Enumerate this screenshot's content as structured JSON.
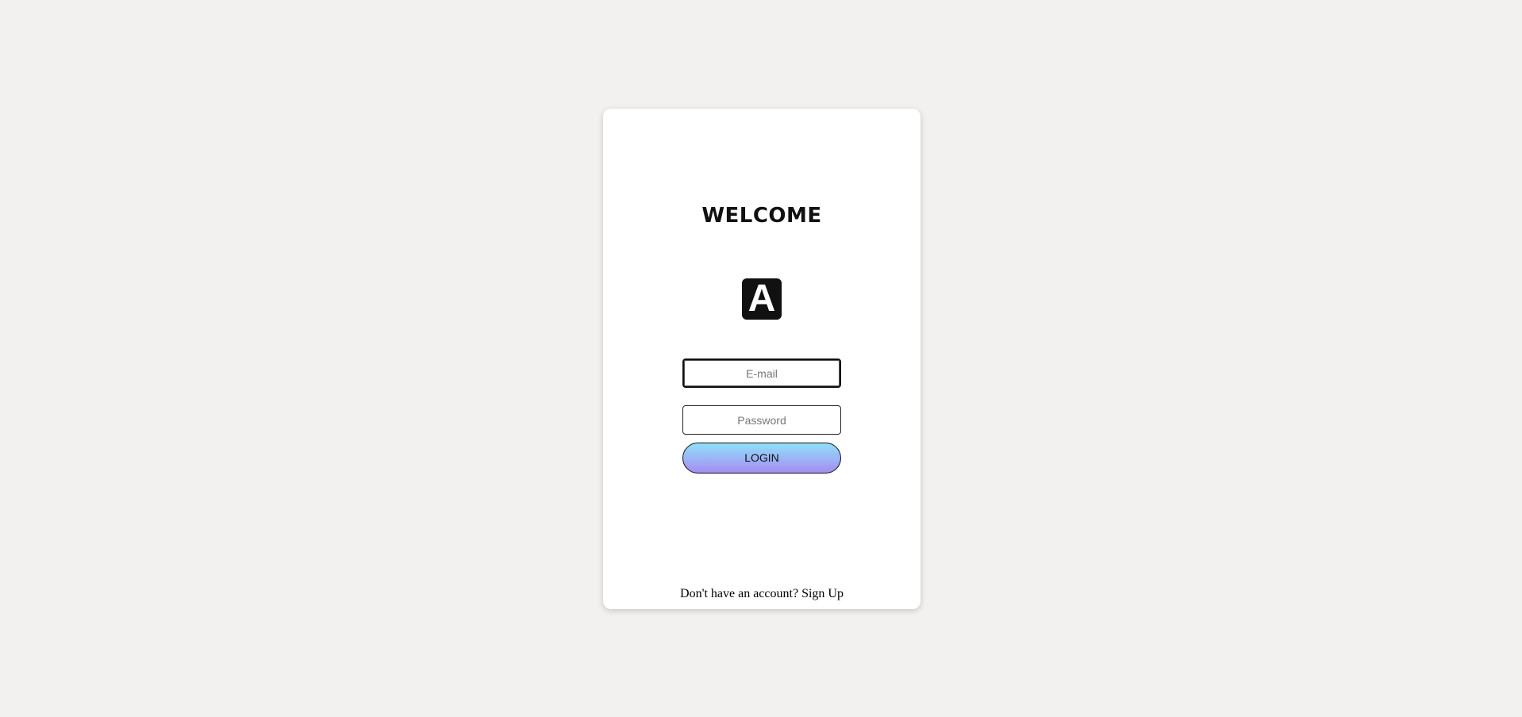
{
  "login_card": {
    "title": "WELCOME",
    "logo_letter": "A",
    "email_placeholder": "E-mail",
    "password_placeholder": "Password",
    "login_label": "LOGIN",
    "signup_prompt": "Don't have an account?",
    "signup_link": "Sign Up"
  },
  "colors": {
    "page_background": "#f2f1ef",
    "card_background": "#ffffff",
    "logo_background": "#111111",
    "button_gradient_top": "#8fe0fa",
    "button_gradient_bottom": "#a58cf2"
  }
}
